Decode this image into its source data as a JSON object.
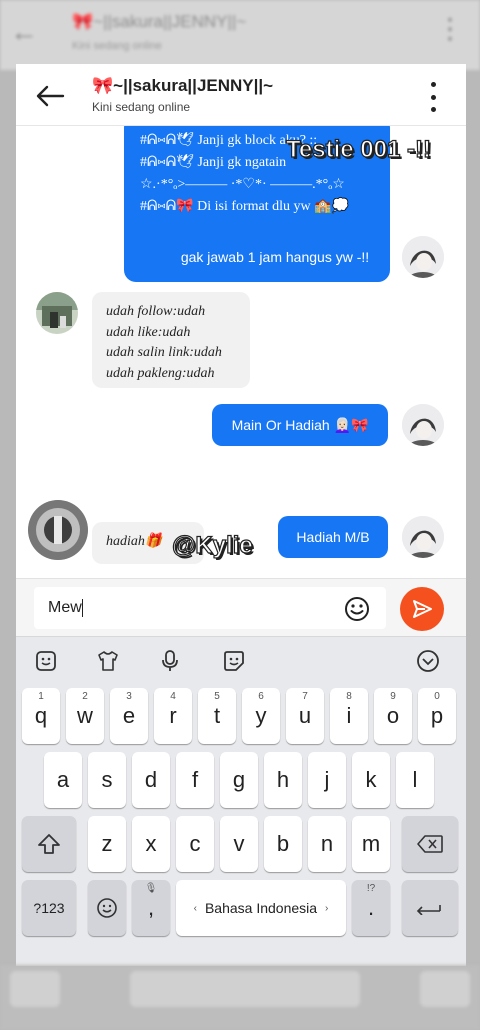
{
  "background_app": {
    "title": "🎀~||sakura||JENNY||~",
    "status": "Kini sedang online",
    "bottom_hint": "Bahasa Indonesia"
  },
  "header": {
    "contact_name": "🎀~||sakura||JENNY||~",
    "status": "Kini sedang online"
  },
  "messages": {
    "big_bubble_lines": [
      "#ᕱ⑅ᕱ🕊 Janji gk block aku? ::",
      "#ᕱ⑅ᕱ🕊 Janji gk ngatain",
      "☆.·*°ₒ>——— ·*♡*· ———.*°ₒ☆",
      "#ᕱ⑅ᕱ🎀 Di isi format dlu yw 🏫💭"
    ],
    "msg1": "gak jawab 1 jam hangus yw -!!",
    "msg2_lines": [
      "udah follow:udah",
      "udah like:udah",
      "udah salin link:udah",
      "udah pakleng:udah"
    ],
    "msg3": "Main Or Hadiah 👩🏻‍🦳🎀",
    "msg4": "hadiah🎁",
    "msg5": "Hadiah M/B"
  },
  "overlays": {
    "testie": "Testie 001 -!!",
    "kylie": "@Kylie"
  },
  "composer": {
    "text": "Mew"
  },
  "keyboard": {
    "row1": [
      {
        "key": "q",
        "num": "1"
      },
      {
        "key": "w",
        "num": "2"
      },
      {
        "key": "e",
        "num": "3"
      },
      {
        "key": "r",
        "num": "4"
      },
      {
        "key": "t",
        "num": "5"
      },
      {
        "key": "y",
        "num": "6"
      },
      {
        "key": "u",
        "num": "7"
      },
      {
        "key": "i",
        "num": "8"
      },
      {
        "key": "o",
        "num": "9"
      },
      {
        "key": "p",
        "num": "0"
      }
    ],
    "row2": [
      "a",
      "s",
      "d",
      "f",
      "g",
      "h",
      "j",
      "k",
      "l"
    ],
    "row3": [
      "z",
      "x",
      "c",
      "v",
      "b",
      "n",
      "m"
    ],
    "symbols_label": "?123",
    "comma": ",",
    "space_label": "Bahasa Indonesia",
    "period": ".",
    "period_hint": "!?"
  },
  "colors": {
    "outgoing_bubble": "#1676f3",
    "incoming_bubble": "#f1f1f1",
    "send_button": "#f4511e"
  }
}
